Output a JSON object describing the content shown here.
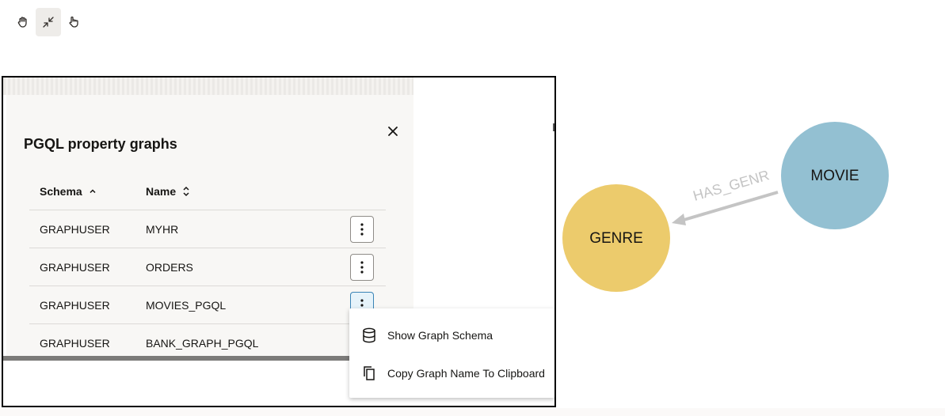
{
  "toolbar": {
    "icons": [
      "pan-hand-icon",
      "collapse-arrows-icon",
      "pan-pointer-icon"
    ]
  },
  "dialog": {
    "title": "PGQL property graphs",
    "close_icon": "close-icon",
    "columns": [
      {
        "label": "Schema",
        "sort": "ascending"
      },
      {
        "label": "Name",
        "sort": "sortable"
      }
    ],
    "rows": [
      {
        "schema": "GRAPHUSER",
        "name": "MYHR"
      },
      {
        "schema": "GRAPHUSER",
        "name": "ORDERS"
      },
      {
        "schema": "GRAPHUSER",
        "name": "MOVIES_PGQL"
      },
      {
        "schema": "GRAPHUSER",
        "name": "BANK_GRAPH_PGQL"
      }
    ],
    "active_row": 2
  },
  "context_menu": {
    "items": [
      {
        "label": "Show Graph Schema",
        "icon": "database-icon"
      },
      {
        "label": "Copy Graph Name To Clipboard",
        "icon": "copy-icon"
      }
    ]
  },
  "graph": {
    "nodes": [
      {
        "label": "MOVIE",
        "color": "#93c0d2"
      },
      {
        "label": "GENRE",
        "color": "#eccb6c"
      }
    ],
    "edge": {
      "label": "HAS_GENR",
      "color": "#c4c4c4"
    }
  }
}
